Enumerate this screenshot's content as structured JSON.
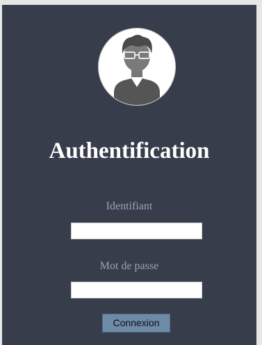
{
  "login": {
    "title": "Authentification",
    "username_label": "Identifiant",
    "username_value": "",
    "password_label": "Mot de passe",
    "password_value": "",
    "submit_label": "Connexion"
  },
  "icons": {
    "avatar": "user-avatar-icon"
  },
  "colors": {
    "page_background": "#e6e6e6",
    "panel_background": "#373d4b",
    "title_text": "#ffffff",
    "label_text": "#9da3b1",
    "button_background": "#6d8aa6"
  }
}
